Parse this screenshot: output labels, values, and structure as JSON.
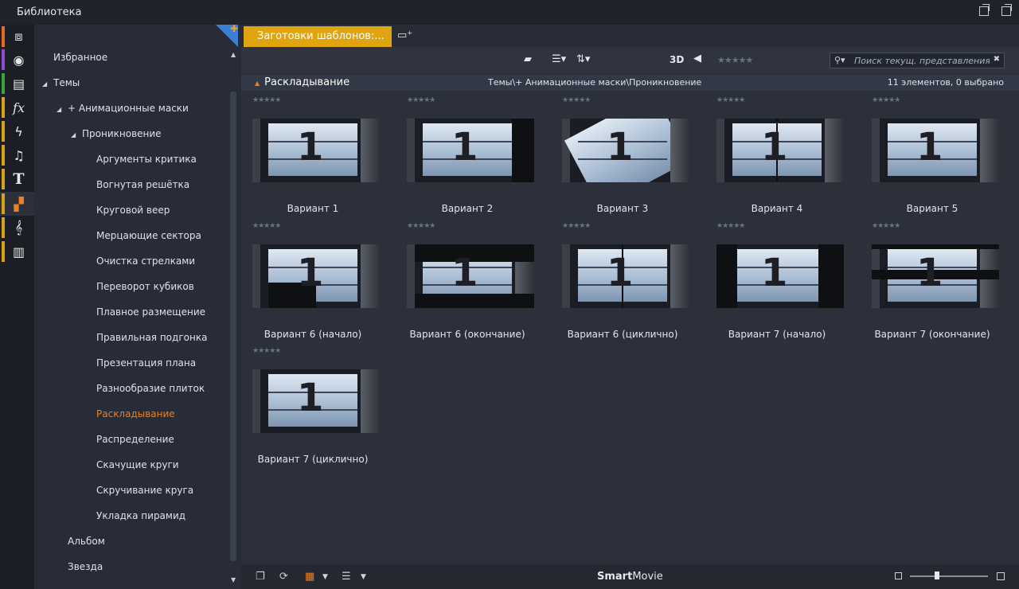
{
  "window": {
    "title": "Библиотека"
  },
  "iconstrip": [
    {
      "icon": "box-icon",
      "glyph": "⧈",
      "color": "#e96a22"
    },
    {
      "icon": "film-reel-icon",
      "glyph": "◉",
      "color": "#8d4fd0"
    },
    {
      "icon": "media-stack-icon",
      "glyph": "▤",
      "color": "#3aa33a"
    },
    {
      "icon": "fx-icon",
      "glyph": "fx",
      "color": "#d6a21a"
    },
    {
      "icon": "lightning-icon",
      "glyph": "ϟ",
      "color": "#d6a21a"
    },
    {
      "icon": "music-note-icon",
      "glyph": "♫",
      "color": "#d6a21a"
    },
    {
      "icon": "text-icon",
      "glyph": "T",
      "color": "#d6a21a"
    },
    {
      "icon": "montage-icon",
      "glyph": "▞",
      "color": "#d6a21a"
    },
    {
      "icon": "treble-clef-icon",
      "glyph": "𝄞",
      "color": "#d6a21a"
    },
    {
      "icon": "piano-icon",
      "glyph": "▥",
      "color": "#d6a21a"
    }
  ],
  "tree": {
    "items": [
      {
        "label": "Избранное",
        "level": 0,
        "expanded": null
      },
      {
        "label": "Темы",
        "level": 0,
        "expanded": true
      },
      {
        "label": "+ Анимационные маски",
        "level": 1,
        "expanded": true
      },
      {
        "label": "Проникновение",
        "level": 2,
        "expanded": true
      },
      {
        "label": "Аргументы критика",
        "level": 3
      },
      {
        "label": "Вогнутая решётка",
        "level": 3
      },
      {
        "label": "Круговой веер",
        "level": 3
      },
      {
        "label": "Мерцающие сектора",
        "level": 3
      },
      {
        "label": "Очистка стрелками",
        "level": 3
      },
      {
        "label": "Переворот кубиков",
        "level": 3
      },
      {
        "label": "Плавное размещение",
        "level": 3
      },
      {
        "label": "Правильная подгонка",
        "level": 3
      },
      {
        "label": "Презентация плана",
        "level": 3
      },
      {
        "label": "Разнообразие плиток",
        "level": 3
      },
      {
        "label": "Раскладывание",
        "level": 3,
        "selected": true
      },
      {
        "label": "Распределение",
        "level": 3
      },
      {
        "label": "Скачущие круги",
        "level": 3
      },
      {
        "label": "Скручивание круга",
        "level": 3
      },
      {
        "label": "Укладка пирамид",
        "level": 3
      },
      {
        "label": "Альбом",
        "level": 1
      },
      {
        "label": "Звезда",
        "level": 1
      }
    ]
  },
  "tab": {
    "label": "Заготовки шаблонов:..."
  },
  "toolbar": {
    "label_3d": "3D",
    "rating": "★★★★★",
    "search_placeholder": "Поиск текущ. представления"
  },
  "pathbar": {
    "folder": "Раскладывание",
    "path": "Темы\\+ Анимационные маски\\Проникновение",
    "count": "11 элементов, 0 выбрано"
  },
  "grid": [
    {
      "label": "Вариант 1",
      "stars": "★★★★★"
    },
    {
      "label": "Вариант 2",
      "stars": "★★★★★"
    },
    {
      "label": "Вариант 3",
      "stars": "★★★★★"
    },
    {
      "label": "Вариант 4",
      "stars": "★★★★★"
    },
    {
      "label": "Вариант 5",
      "stars": "★★★★★"
    },
    {
      "label": "Вариант 6 (начало)",
      "stars": "★★★★★"
    },
    {
      "label": "Вариант 6 (окончание)",
      "stars": "★★★★★"
    },
    {
      "label": "Вариант 6 (циклично)",
      "stars": "★★★★★"
    },
    {
      "label": "Вариант 7 (начало)",
      "stars": "★★★★★"
    },
    {
      "label": "Вариант 7 (окончание)",
      "stars": "★★★★★"
    },
    {
      "label": "Вариант 7 (циклично)",
      "stars": "★★★★★"
    }
  ],
  "thumb_digit": "1",
  "bottombar": {
    "brand_bold": "Smart",
    "brand_rest": "Movie"
  },
  "zoom": {
    "level": 0.35
  },
  "colors": {
    "accent": "#f07f22",
    "tab": "#e0a40f"
  }
}
